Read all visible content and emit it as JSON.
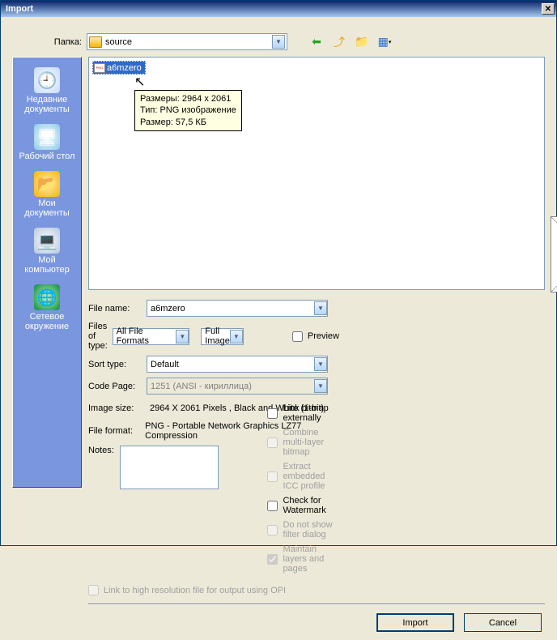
{
  "title": "Import",
  "folder_label": "Папка:",
  "folder_value": "source",
  "sidebar": {
    "recent": "Недавние документы",
    "desktop": "Рабочий стол",
    "docs": "Мои документы",
    "computer": "Мой компьютер",
    "network": "Сетевое окружение"
  },
  "file": {
    "name": "a6mzero"
  },
  "tooltip": {
    "l1": "Размеры: 2964 x 2061",
    "l2": "Тип: PNG изображение",
    "l3": "Размер: 57,5 КБ"
  },
  "labels": {
    "filename": "File name:",
    "filetype": "Files of type:",
    "sorttype": "Sort type:",
    "codepage": "Code Page:",
    "imagesize": "Image size:",
    "fileformat": "File format:",
    "notes": "Notes:"
  },
  "values": {
    "filename": "a6mzero",
    "filetype": "All File Formats",
    "sorttype": "Default",
    "codepage": "1251  (ANSI - кириллица)",
    "imagesize": "2964 X 2061 Pixels , Black and White (1-bit)",
    "fileformat": "PNG - Portable Network Graphics LZ77 Compression",
    "fullimage": "Full Image"
  },
  "checks": {
    "preview": "Preview",
    "link_ext": "Link bitmap externally",
    "combine": "Combine multi-layer bitmap",
    "extract": "Extract embedded ICC profile",
    "watermark": "Check for Watermark",
    "nofilter": "Do not show filter dialog",
    "maintain": "Maintain layers and pages"
  },
  "opi": "Link to high resolution file for output using OPI",
  "buttons": {
    "import": "Import",
    "cancel": "Cancel"
  }
}
